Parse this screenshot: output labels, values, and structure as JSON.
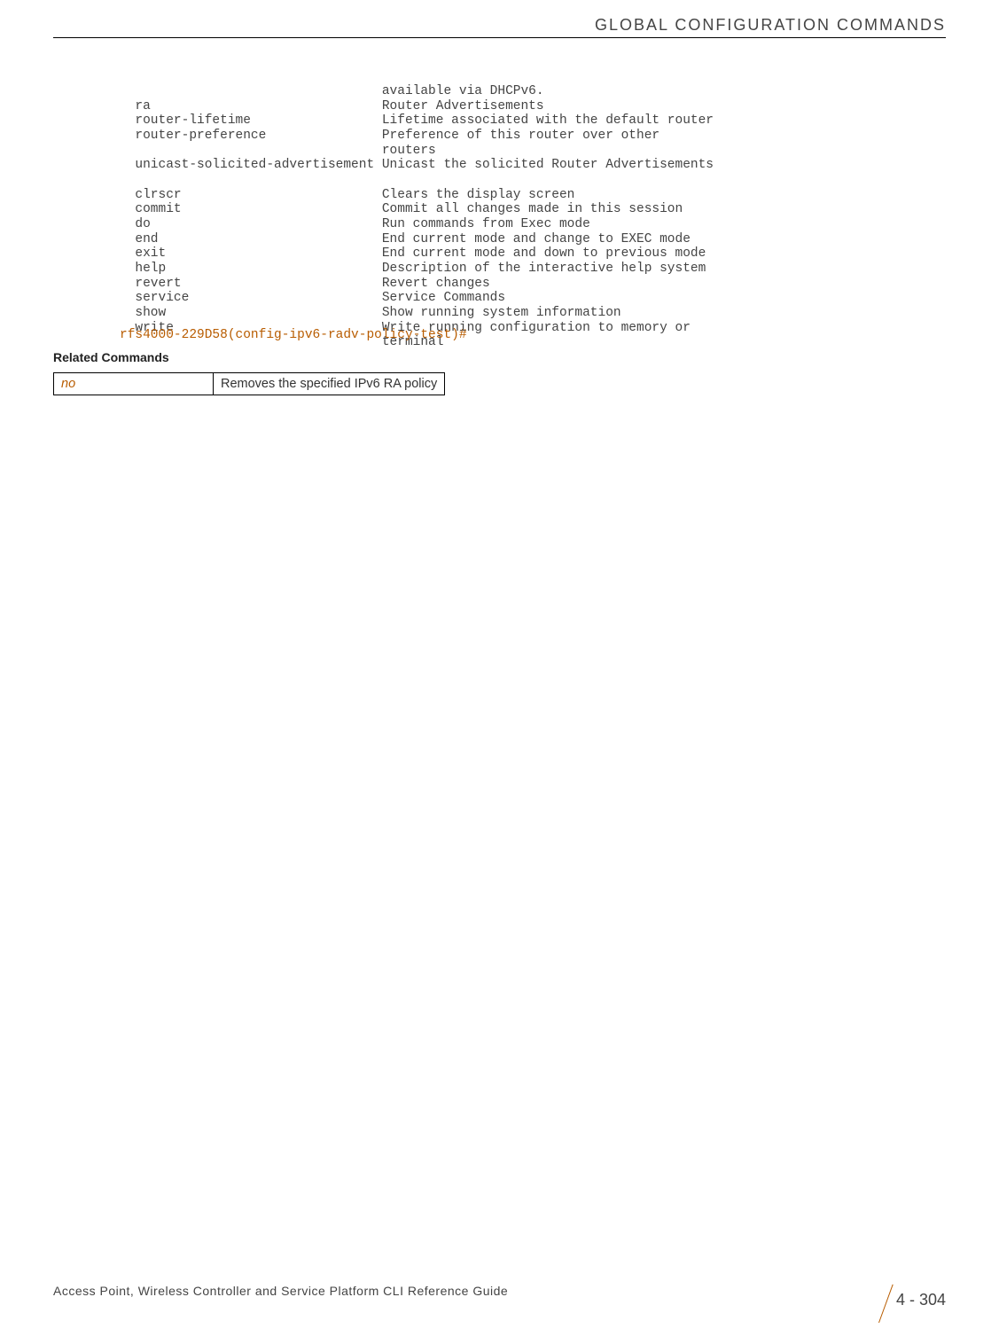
{
  "header": {
    "title": "GLOBAL CONFIGURATION COMMANDS"
  },
  "code": {
    "line1": "                                  available via DHCPv6.",
    "line2": "  ra                              Router Advertisements",
    "line3": "  router-lifetime                 Lifetime associated with the default router",
    "line4": "  router-preference               Preference of this router over other",
    "line5": "                                  routers",
    "line6": "  unicast-solicited-advertisement Unicast the solicited Router Advertisements",
    "line7": "",
    "line8": "  clrscr                          Clears the display screen",
    "line9": "  commit                          Commit all changes made in this session",
    "line10": "  do                              Run commands from Exec mode",
    "line11": "  end                             End current mode and change to EXEC mode",
    "line12": "  exit                            End current mode and down to previous mode",
    "line13": "  help                            Description of the interactive help system",
    "line14": "  revert                          Revert changes",
    "line15": "  service                         Service Commands",
    "line16": "  show                            Show running system information",
    "line17": "  write                           Write running configuration to memory or",
    "line18": "                                  terminal"
  },
  "prompt": "rfs4000-229D58(config-ipv6-radv-policy-test)#",
  "related": {
    "heading": "Related Commands",
    "rows": [
      {
        "cmd": "no",
        "desc": "Removes the specified IPv6 RA policy"
      }
    ]
  },
  "footer": {
    "text": "Access Point, Wireless Controller and Service Platform CLI Reference Guide",
    "page": "4 - 304"
  }
}
